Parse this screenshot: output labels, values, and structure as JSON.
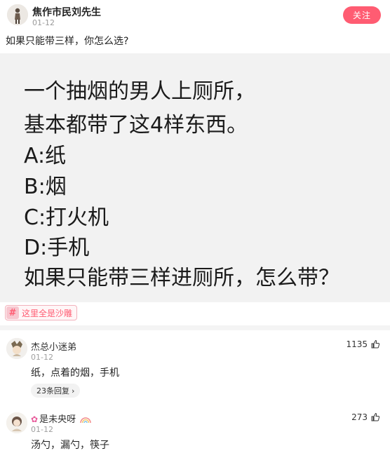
{
  "post": {
    "author": "焦作市民刘先生",
    "date": "01-12",
    "follow_label": "关注",
    "title": "如果只能带三样，你怎么选?",
    "image_lines": [
      "一个抽烟的男人上厕所，",
      "基本都带了这4样东西。",
      "A:纸",
      "B:烟",
      "C:打火机",
      "D:手机",
      "如果只能带三样进厕所，怎么带？"
    ],
    "tag_icon": "#",
    "tag_label": "这里全是沙雕"
  },
  "comments": [
    {
      "author": "杰总小迷弟",
      "date": "01-12",
      "text": "纸，点着的烟，手机",
      "likes": "1135",
      "replies_label": "23条回复"
    },
    {
      "author_emoji": "✿",
      "author": "是未央呀",
      "date": "01-12",
      "text": "汤勺，漏勺，筷子",
      "likes": "273"
    }
  ],
  "icons": {
    "like": "thumbs-up-icon",
    "chevron": "chevron-right-icon",
    "tag": "hashtag-icon"
  },
  "colors": {
    "accent": "#ff5c72",
    "muted": "#9a9a9a"
  }
}
